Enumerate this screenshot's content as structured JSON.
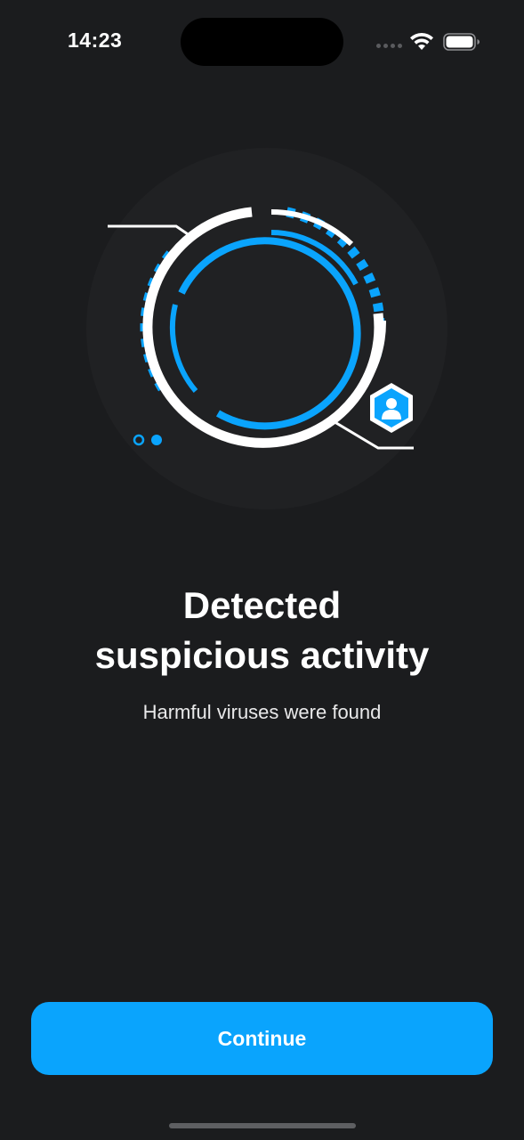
{
  "status_bar": {
    "time": "14:23"
  },
  "illustration": {
    "icon": "shield-scan-illustration",
    "badge_icon": "user-hexagon-icon",
    "colors": {
      "accent": "#0aa4fd",
      "ring": "#ffffff",
      "backdrop": "#202123"
    }
  },
  "main": {
    "title_line1": "Detected",
    "title_line2": "suspicious activity",
    "subtitle": "Harmful viruses were found"
  },
  "actions": {
    "continue_label": "Continue"
  },
  "colors": {
    "background": "#1b1c1e",
    "button": "#0aa4fd",
    "text": "#ffffff"
  }
}
